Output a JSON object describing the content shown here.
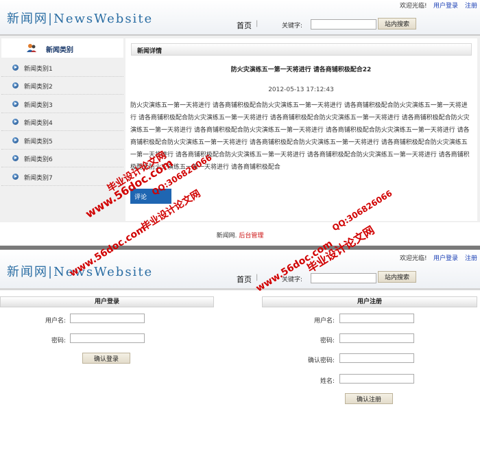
{
  "site": {
    "logo": "新闻网|NewsWebsite",
    "welcome": "欢迎光临!",
    "user_login_link": "用户登录",
    "register_link": "注册",
    "nav_home": "首页",
    "nav_sep": "|",
    "keyword_label": "关键字:",
    "search_button": "站内搜索"
  },
  "sidebar": {
    "title": "新闻类别",
    "items": [
      {
        "label": "新闻类别1"
      },
      {
        "label": "新闻类别2"
      },
      {
        "label": "新闻类别3"
      },
      {
        "label": "新闻类别4"
      },
      {
        "label": "新闻类别5"
      },
      {
        "label": "新闻类别6"
      },
      {
        "label": "新闻类别7"
      }
    ]
  },
  "article": {
    "section_title": "新闻详情",
    "title": "防火灾演练五一第一天将进行 请各商铺积极配合22",
    "date": "2012-05-13 17:12:43",
    "body": "防火灾演练五一第一天将进行 请各商铺积极配合防火灾演练五一第一天将进行 请各商铺积极配合防火灾演练五一第一天将进行 请各商铺积极配合防火灾演练五一第一天将进行 请各商铺积极配合防火灾演练五一第一天将进行 请各商铺积极配合防火灾演练五一第一天将进行 请各商铺积极配合防火灾演练五一第一天将进行 请各商铺积极配合防火灾演练五一第一天将进行 请各商铺积极配合防火灾演练五一第一天将进行 请各商铺积极配合防火灾演练五一第一天将进行 请各商铺积极配合防火灾演练五一第一天将进行 请各商铺积极配合防火灾演练五一第一天将进行 请各商铺积极配合防火灾演练五一第一天将进行 请各商铺积极配合防火灾演练五一第一天将进行 请各商铺积极配合",
    "comment_tab": "评论"
  },
  "footer": {
    "site_name": "新闻网.",
    "admin_link": "后台管理"
  },
  "login": {
    "title": "用户登录",
    "username_label": "用户名:",
    "password_label": "密码:",
    "submit": "确认登录"
  },
  "register": {
    "title": "用户注册",
    "username_label": "用户名:",
    "password_label": "密码:",
    "confirm_label": "确认密码:",
    "name_label": "姓名:",
    "submit": "确认注册"
  },
  "watermarks": {
    "site": "www.56doc.com",
    "qq": "QQ:306826066",
    "name": "毕业设计论文网"
  },
  "colors": {
    "accent_blue": "#2a6da3",
    "link_blue": "#1a3fb5",
    "watermark_red": "#d10000",
    "comment_tab_blue": "#1f66b2"
  }
}
